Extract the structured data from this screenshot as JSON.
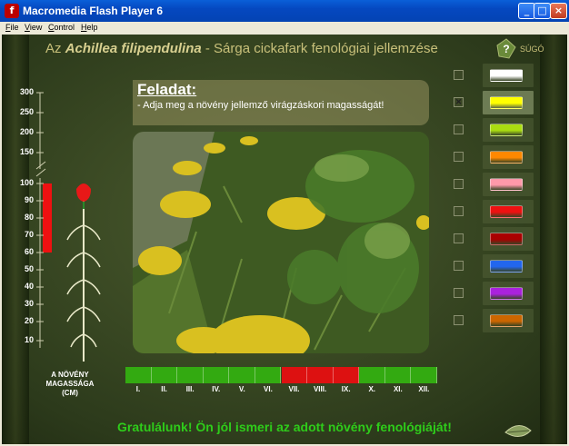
{
  "window": {
    "title": "Macromedia Flash Player 6",
    "icon": "flash-icon",
    "controls": [
      "_",
      "□",
      "×"
    ]
  },
  "menu": {
    "items": [
      {
        "label": "File",
        "accel": "F"
      },
      {
        "label": "View",
        "accel": "V"
      },
      {
        "label": "Control",
        "accel": "C"
      },
      {
        "label": "Help",
        "accel": "H"
      }
    ]
  },
  "header": {
    "prefix": "Az ",
    "species": "Achillea filipendulina",
    "rest": " - Sárga cickafark fenológiai jellemzése"
  },
  "help": {
    "label": "SÚGÓ"
  },
  "task": {
    "title": "Feladat:",
    "text": "- Adja meg a növény jellemző virágzáskori magasságát!"
  },
  "height_scale": {
    "ticks": [
      "300",
      "250",
      "200",
      "150",
      "100",
      "90",
      "80",
      "70",
      "60",
      "50",
      "40",
      "30",
      "20",
      "10"
    ],
    "label_line1": "A NÖVÉNY",
    "label_line2": "MAGASSÁGA (CM)",
    "selected_from_cm": 60,
    "selected_to_cm": 100,
    "fill_color": "#ee1111"
  },
  "colors": {
    "items": [
      {
        "name": "white",
        "hex": "#ffffff",
        "checked": false
      },
      {
        "name": "yellow",
        "hex": "#ffff00",
        "checked": true
      },
      {
        "name": "yellow-green",
        "hex": "#aadd11",
        "checked": false
      },
      {
        "name": "orange",
        "hex": "#ff8800",
        "checked": false
      },
      {
        "name": "pink",
        "hex": "#ff99aa",
        "checked": false
      },
      {
        "name": "red",
        "hex": "#ee1111",
        "checked": false
      },
      {
        "name": "dark-red",
        "hex": "#aa0000",
        "checked": false
      },
      {
        "name": "blue",
        "hex": "#2266ee",
        "checked": false
      },
      {
        "name": "purple",
        "hex": "#aa22dd",
        "checked": false
      },
      {
        "name": "brown-orange",
        "hex": "#cc6600",
        "checked": false
      }
    ]
  },
  "months": {
    "labels": [
      "I.",
      "II.",
      "III.",
      "IV.",
      "V.",
      "VI.",
      "VII.",
      "VIII.",
      "IX.",
      "X.",
      "XI.",
      "XII."
    ],
    "states": [
      "green",
      "green",
      "green",
      "green",
      "green",
      "green",
      "red",
      "red",
      "red",
      "green",
      "green",
      "green"
    ],
    "green": "#33aa11",
    "red": "#dd1111"
  },
  "footer": {
    "message": "Gratulálunk! Ön jól ismeri az adott növény fenológiáját!",
    "color": "#2ecc1a"
  }
}
